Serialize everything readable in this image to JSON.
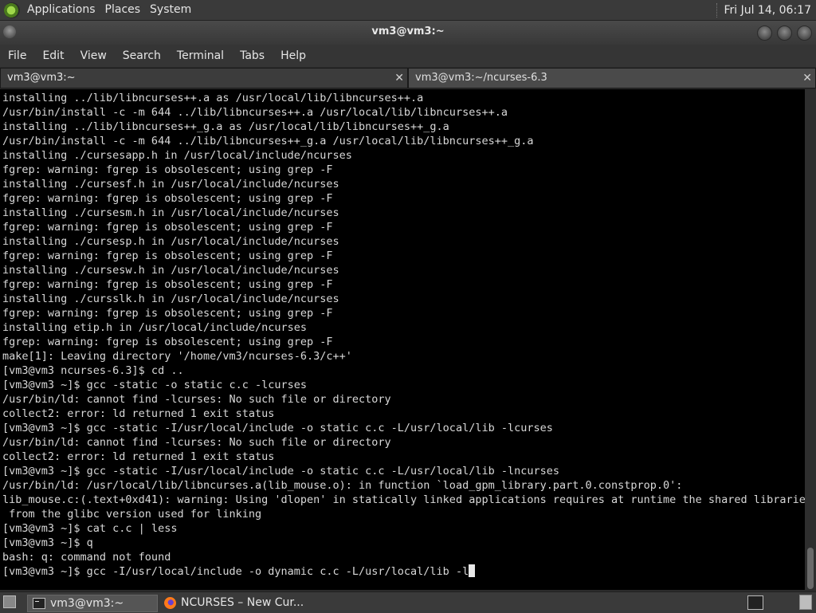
{
  "top_panel": {
    "menus": [
      "Applications",
      "Places",
      "System"
    ],
    "clock": "Fri Jul 14, 06:17"
  },
  "window": {
    "title": "vm3@vm3:~"
  },
  "menubar": {
    "items": [
      "File",
      "Edit",
      "View",
      "Search",
      "Terminal",
      "Tabs",
      "Help"
    ]
  },
  "tabs": [
    {
      "label": "vm3@vm3:~",
      "active": true
    },
    {
      "label": "vm3@vm3:~/ncurses-6.3",
      "active": false
    }
  ],
  "terminal": {
    "lines": [
      "installing ../lib/libncurses++.a as /usr/local/lib/libncurses++.a",
      "/usr/bin/install -c -m 644 ../lib/libncurses++.a /usr/local/lib/libncurses++.a",
      "installing ../lib/libncurses++_g.a as /usr/local/lib/libncurses++_g.a",
      "/usr/bin/install -c -m 644 ../lib/libncurses++_g.a /usr/local/lib/libncurses++_g.a",
      "installing ./cursesapp.h in /usr/local/include/ncurses",
      "fgrep: warning: fgrep is obsolescent; using grep -F",
      "installing ./cursesf.h in /usr/local/include/ncurses",
      "fgrep: warning: fgrep is obsolescent; using grep -F",
      "installing ./cursesm.h in /usr/local/include/ncurses",
      "fgrep: warning: fgrep is obsolescent; using grep -F",
      "installing ./cursesp.h in /usr/local/include/ncurses",
      "fgrep: warning: fgrep is obsolescent; using grep -F",
      "installing ./cursesw.h in /usr/local/include/ncurses",
      "fgrep: warning: fgrep is obsolescent; using grep -F",
      "installing ./cursslk.h in /usr/local/include/ncurses",
      "fgrep: warning: fgrep is obsolescent; using grep -F",
      "installing etip.h in /usr/local/include/ncurses",
      "fgrep: warning: fgrep is obsolescent; using grep -F",
      "make[1]: Leaving directory '/home/vm3/ncurses-6.3/c++'",
      "[vm3@vm3 ncurses-6.3]$ cd ..",
      "[vm3@vm3 ~]$ gcc -static -o static c.c -lcurses",
      "/usr/bin/ld: cannot find -lcurses: No such file or directory",
      "collect2: error: ld returned 1 exit status",
      "[vm3@vm3 ~]$ gcc -static -I/usr/local/include -o static c.c -L/usr/local/lib -lcurses",
      "/usr/bin/ld: cannot find -lcurses: No such file or directory",
      "collect2: error: ld returned 1 exit status",
      "[vm3@vm3 ~]$ gcc -static -I/usr/local/include -o static c.c -L/usr/local/lib -lncurses",
      "/usr/bin/ld: /usr/local/lib/libncurses.a(lib_mouse.o): in function `load_gpm_library.part.0.constprop.0':",
      "lib_mouse.c:(.text+0xd41): warning: Using 'dlopen' in statically linked applications requires at runtime the shared libraries",
      " from the glibc version used for linking",
      "[vm3@vm3 ~]$ cat c.c | less",
      "[vm3@vm3 ~]$ q",
      "bash: q: command not found",
      "[vm3@vm3 ~]$ gcc -I/usr/local/include -o dynamic c.c -L/usr/local/lib -l"
    ]
  },
  "taskbar": {
    "tasks": [
      {
        "label": "vm3@vm3:~",
        "icon": "terminal-icon",
        "active": true
      },
      {
        "label": "NCURSES – New Cur...",
        "icon": "firefox-icon",
        "active": false
      }
    ]
  }
}
